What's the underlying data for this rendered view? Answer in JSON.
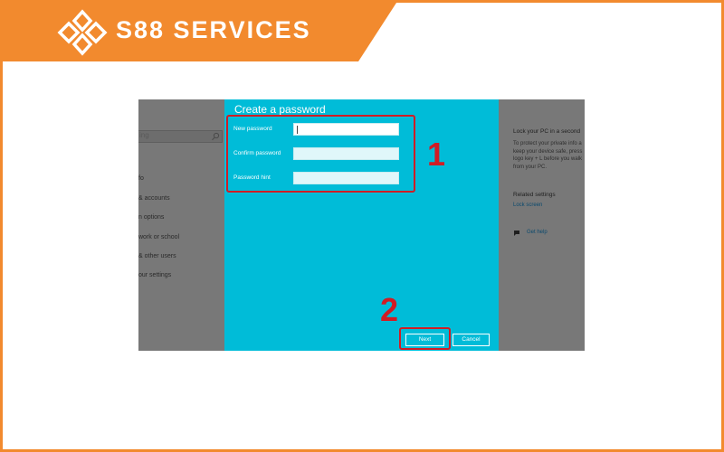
{
  "brand": {
    "name": "S88 SERVICES",
    "icon": "s88-diamond-logo-icon",
    "color": "#f28a2e"
  },
  "settings_left": {
    "search_placeholder": "ing",
    "nav_items": [
      "fo",
      "& accounts",
      "n options",
      "work or school",
      "& other users",
      "our settings"
    ]
  },
  "dialog": {
    "title": "Create a password",
    "fields": [
      {
        "label": "New password",
        "value": ""
      },
      {
        "label": "Confirm password",
        "value": ""
      },
      {
        "label": "Password hint",
        "value": ""
      }
    ],
    "next_label": "Next",
    "cancel_label": "Cancel",
    "bg_color": "#00bcd8"
  },
  "settings_right": {
    "title": "Lock your PC in a second",
    "text": "To protect your private info a\nkeep your device safe, press\nlogo key + L before you walk\nfrom your PC.",
    "related_heading": "Related settings",
    "related_link": "Lock screen",
    "help_label": "Get help"
  },
  "annotations": {
    "step1": "1",
    "step2": "2",
    "color": "#d11c24"
  }
}
